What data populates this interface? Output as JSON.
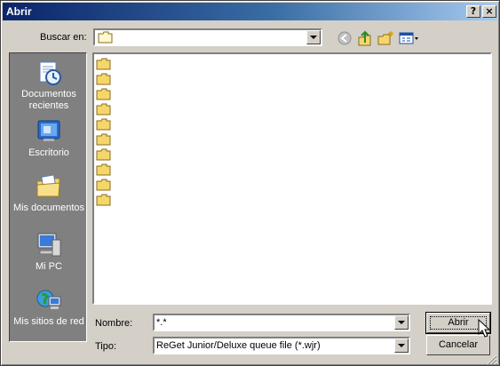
{
  "window": {
    "title": "Abrir",
    "help_label": "?",
    "close_label": "×"
  },
  "toolbar": {
    "lookin_label": "Buscar en:",
    "lookin_value": "",
    "icons": [
      "back-icon",
      "up-folder-icon",
      "new-folder-icon",
      "view-menu-icon"
    ]
  },
  "places": [
    {
      "label": "Documentos recientes",
      "icon": "recent-documents-icon"
    },
    {
      "label": "Escritorio",
      "icon": "desktop-icon"
    },
    {
      "label": "Mis documentos",
      "icon": "my-documents-icon"
    },
    {
      "label": "Mi PC",
      "icon": "my-computer-icon"
    },
    {
      "label": "Mis sitios de red",
      "icon": "network-places-icon"
    }
  ],
  "file_list": {
    "folder_count": 10
  },
  "filename": {
    "label": "Nombre:",
    "value": "*.*"
  },
  "filetype": {
    "label": "Tipo:",
    "value": "ReGet Junior/Deluxe queue file (*.wjr)"
  },
  "buttons": {
    "open": "Abrir",
    "cancel": "Cancelar"
  },
  "colors": {
    "title_start": "#0a246a",
    "title_end": "#a6caf0",
    "dialog_bg": "#d4d0c8",
    "places_bg": "#808080",
    "folder": "#f6d66a"
  }
}
